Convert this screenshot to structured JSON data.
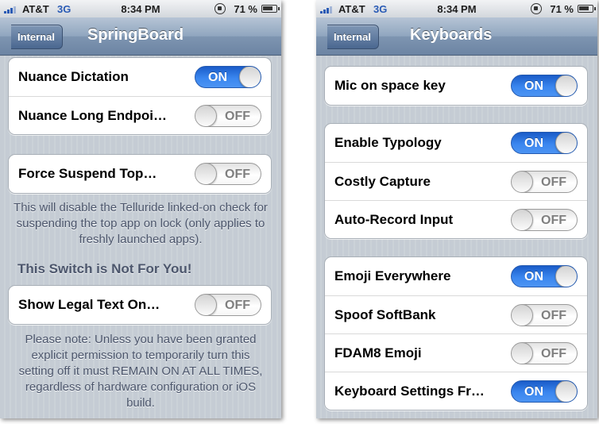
{
  "left": {
    "status": {
      "carrier": "AT&T",
      "network": "3G",
      "time": "8:34 PM",
      "battery": "71 %"
    },
    "nav": {
      "back_label": "Internal",
      "title": "SpringBoard"
    },
    "group1": [
      {
        "label": "Nuance Dictation",
        "state": "ON"
      },
      {
        "label": "Nuance Long Endpoi…",
        "state": "OFF"
      }
    ],
    "group2": [
      {
        "label": "Force Suspend Top…",
        "state": "OFF"
      }
    ],
    "group2_footer": "This will disable the Telluride linked-on check for suspending the top app on lock (only applies to freshly launched apps).",
    "group3_header": "This Switch is Not For You!",
    "group3": [
      {
        "label": "Show Legal Text On…",
        "state": "OFF"
      }
    ],
    "group3_footer": "Please note: Unless you have been granted explicit permission to temporarily turn this setting off it must REMAIN ON AT ALL TIMES, regardless of hardware configuration or iOS build."
  },
  "right": {
    "status": {
      "carrier": "AT&T",
      "network": "3G",
      "time": "8:34 PM",
      "battery": "71 %"
    },
    "nav": {
      "back_label": "Internal",
      "title": "Keyboards"
    },
    "group1": [
      {
        "label": "Mic on space key",
        "state": "ON"
      }
    ],
    "group2": [
      {
        "label": "Enable Typology",
        "state": "ON"
      },
      {
        "label": "Costly Capture",
        "state": "OFF"
      },
      {
        "label": "Auto-Record Input",
        "state": "OFF"
      }
    ],
    "group3": [
      {
        "label": "Emoji Everywhere",
        "state": "ON"
      },
      {
        "label": "Spoof SoftBank",
        "state": "OFF"
      },
      {
        "label": "FDAM8 Emoji",
        "state": "OFF"
      },
      {
        "label": "Keyboard Settings Fr…",
        "state": "ON"
      }
    ]
  },
  "colors": {
    "switch_on": "#3a86ef",
    "nav_bar": "#7e95b1",
    "background": "#c5ccd4"
  },
  "icons": [
    "signal-bars-icon",
    "rotation-lock-icon",
    "battery-icon",
    "back-chevron-icon"
  ]
}
